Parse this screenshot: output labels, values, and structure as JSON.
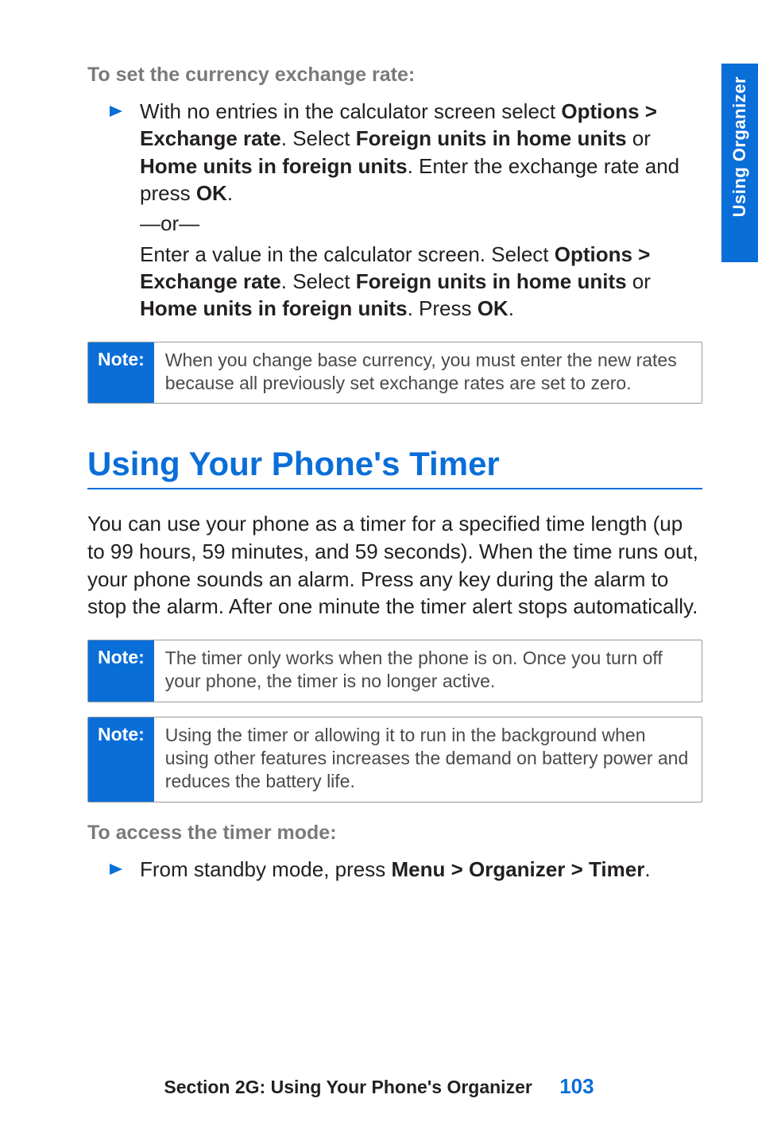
{
  "sideTab": "Using Organizer",
  "section1": {
    "heading": "To set the currency exchange rate:",
    "step1_part1": "With no entries in the calculator screen select ",
    "step1_bold1": "Options > Exchange rate",
    "step1_part2": ". Select ",
    "step1_bold2": "Foreign units in home units",
    "step1_part3": " or ",
    "step1_bold3": "Home units in foreign units",
    "step1_part4": ". Enter the exchange rate and press ",
    "step1_bold4": "OK",
    "step1_part5": ".",
    "or": "—or—",
    "step2_part1": "Enter a value in the calculator screen. Select ",
    "step2_bold1": "Options > Exchange rate",
    "step2_part2": ". Select ",
    "step2_bold2": "Foreign units in home units",
    "step2_part3": " or ",
    "step2_bold3": "Home units in foreign units",
    "step2_part4": ". Press ",
    "step2_bold4": "OK",
    "step2_part5": "."
  },
  "noteLabel": "Note:",
  "note1": "When you change base currency, you must enter the new rates because all previously set exchange rates are set to zero.",
  "title": "Using Your Phone's Timer",
  "para1": "You can use your phone as a timer for a specified time length (up to 99 hours, 59 minutes, and 59 seconds). When the time runs out, your phone sounds an alarm. Press any key during the alarm to stop the alarm. After one minute the timer alert stops automatically.",
  "note2": "The timer only works when the phone is on. Once you turn off your phone, the timer is no longer active.",
  "note3": "Using the timer or allowing it to run in the background when using other features increases the demand on battery power and reduces the battery life.",
  "section2": {
    "heading": "To access the timer mode:",
    "step_part1": "From standby mode, press ",
    "step_bold1": "Menu > Organizer > Timer",
    "step_part2": "."
  },
  "footer": {
    "section": "Section 2G: Using Your Phone's Organizer",
    "page": "103"
  }
}
